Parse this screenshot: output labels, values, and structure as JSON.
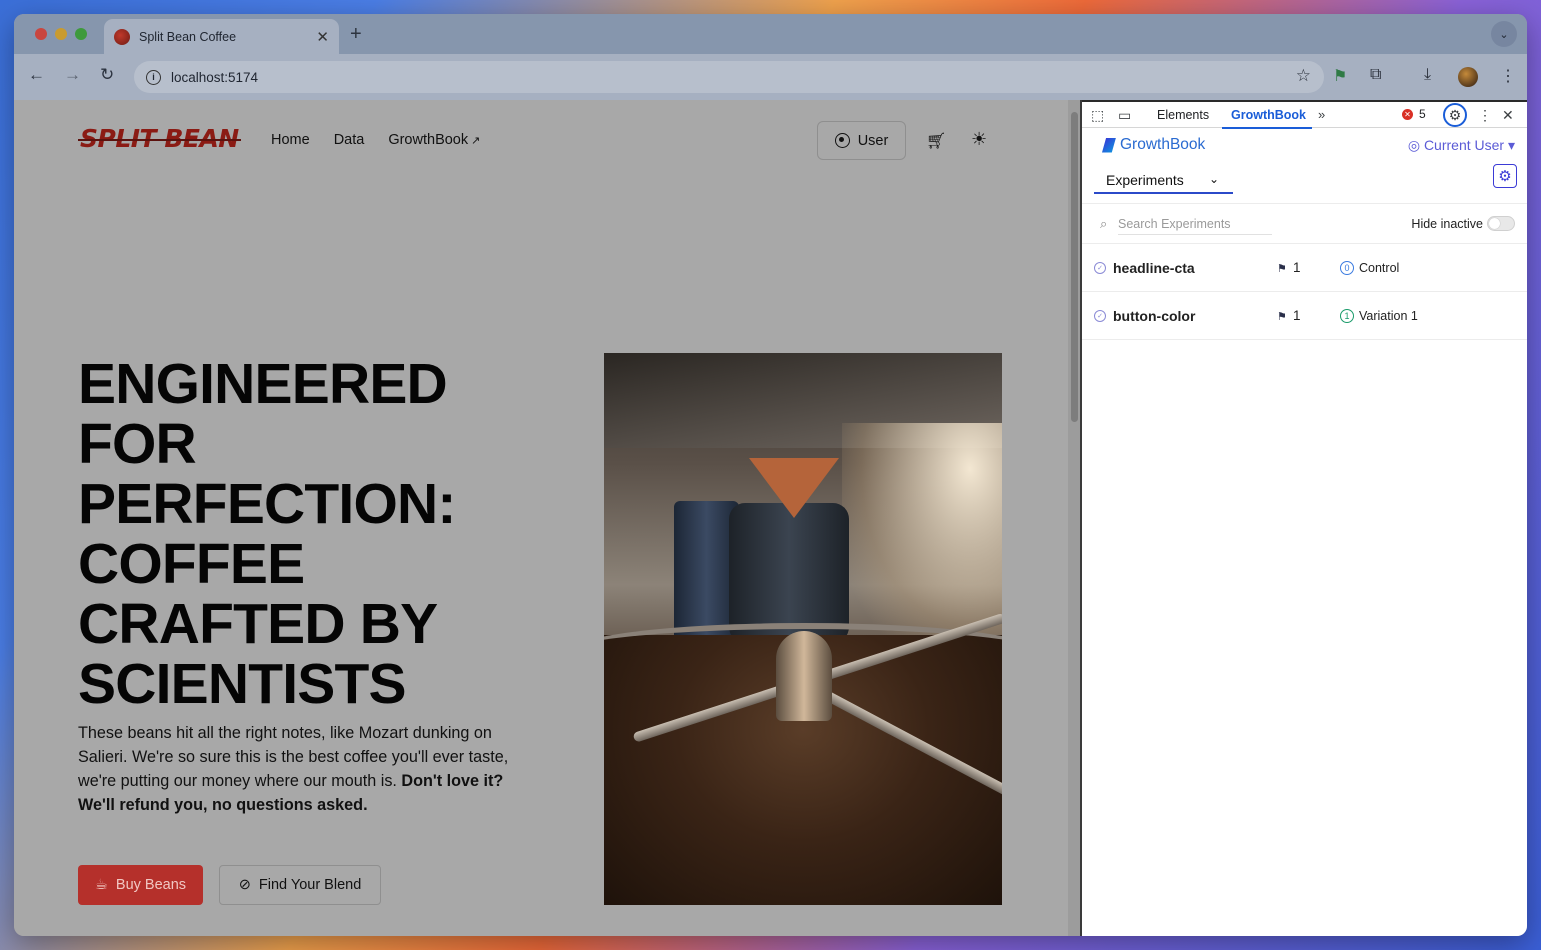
{
  "browser": {
    "tab_title": "Split Bean Coffee",
    "tab_close": "✕",
    "new_tab": "+",
    "url": "localhost:5174"
  },
  "site": {
    "logo": "SPLIT BEAN",
    "nav": [
      {
        "label": "Home"
      },
      {
        "label": "Data"
      },
      {
        "label": "GrowthBook"
      }
    ],
    "user_button": "User",
    "headline_lines": [
      "ENGINEERED",
      "FOR",
      "PERFECTION:",
      "COFFEE",
      "CRAFTED BY",
      "SCIENTISTS"
    ],
    "body_plain": "These beans hit all the right notes, like Mozart dunking on Salieri. We're so sure this is the best coffee you'll ever taste, we're putting our money where our mouth is. ",
    "body_bold": "Don't love it? We'll refund you, no questions asked.",
    "buy_button": "Buy Beans",
    "blend_button": "Find Your Blend"
  },
  "devtools": {
    "tabs": [
      "Elements",
      "GrowthBook"
    ],
    "active_tab": "GrowthBook",
    "error_count": "5"
  },
  "growthbook": {
    "logo_text": "GrowthBook",
    "current_user": "Current User",
    "panel_tab": "Experiments",
    "search_placeholder": "Search Experiments",
    "hide_inactive_label": "Hide inactive",
    "hide_inactive_on": false,
    "experiments": [
      {
        "name": "headline-cta",
        "count": "1",
        "variation_index": "0",
        "variation_label": "Control",
        "variation_color": "#3b7be0"
      },
      {
        "name": "button-color",
        "count": "1",
        "variation_index": "1",
        "variation_label": "Variation 1",
        "variation_color": "#1a9b6a"
      }
    ]
  },
  "colors": {
    "brand_red": "#b5302b",
    "devtools_accent": "#1a5dd8",
    "growthbook_accent": "#3b3bd6"
  }
}
